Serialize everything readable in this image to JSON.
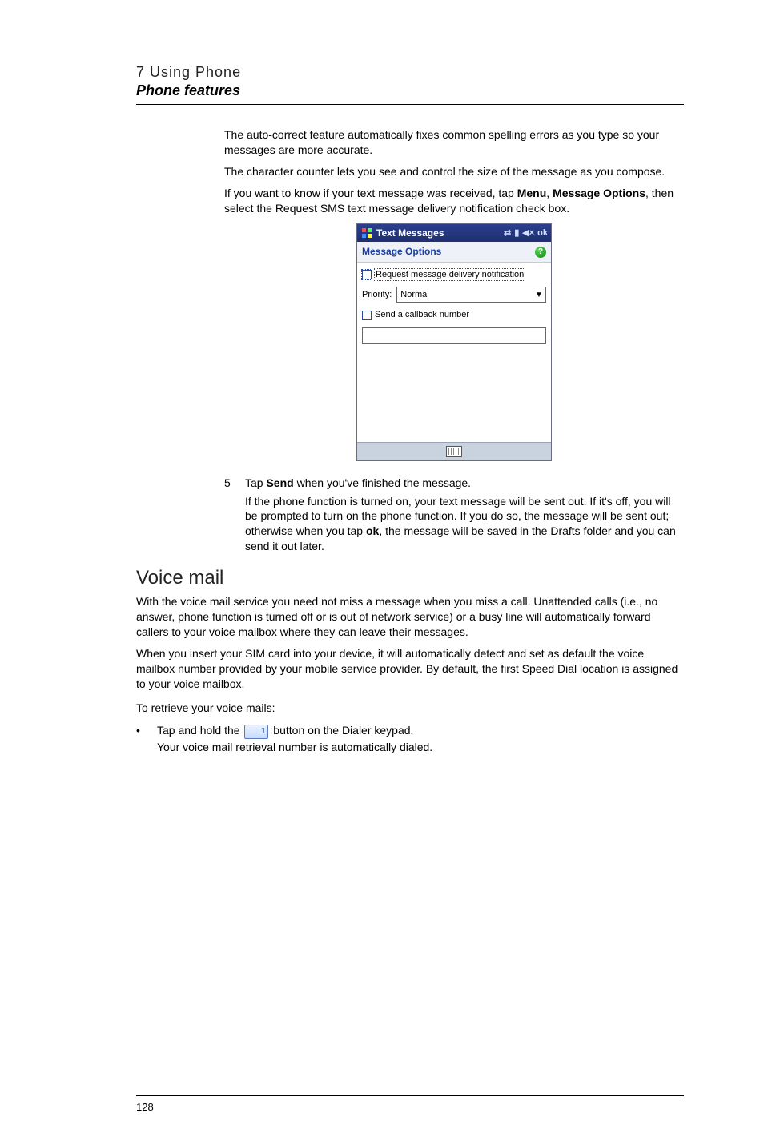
{
  "header": {
    "chapter": "7 Using Phone",
    "section": "Phone features"
  },
  "intro": {
    "p1": "The auto-correct feature automatically fixes common spelling errors as you type so your messages are more accurate.",
    "p2": "The character counter lets you see and control the size of the message as you compose.",
    "p3_pre": "If you want to know if your text message was received, tap ",
    "p3_b1": "Menu",
    "p3_mid": ", ",
    "p3_b2": "Message Options",
    "p3_post": ", then select the Request SMS text message delivery notification check box."
  },
  "mobile": {
    "title": "Text Messages",
    "ok": "ok",
    "subtitle": "Message Options",
    "opt_request": "Request message delivery notification",
    "priority_label": "Priority:",
    "priority_value": "Normal",
    "opt_callback": "Send a callback number"
  },
  "step5": {
    "num": "5",
    "pre": "Tap ",
    "b": "Send",
    "post": " when you've finished the message.",
    "follow_pre": "If the phone function is turned on, your text message will be sent out. If it's off, you will be prompted to turn on the phone function. If you do so, the message will be sent out; otherwise when you tap ",
    "follow_b": "ok",
    "follow_post": ", the message will be saved in the Drafts folder and you can send it out later."
  },
  "voicemail": {
    "heading": "Voice mail",
    "p1": "With the voice mail service you need not miss a message when you miss a call. Unattended calls (i.e., no answer, phone function is turned off or is out of network service) or a busy line will automatically forward callers to your voice mailbox where they can leave their messages.",
    "p2": "When you insert your SIM card into your device, it will automatically detect and set as default the voice mailbox number provided by your mobile service provider. By default, the first Speed Dial location is assigned to your voice mailbox.",
    "task": "To retrieve your voice mails:",
    "bullet_pre": "Tap and hold the ",
    "bullet_post": " button on the Dialer keypad.",
    "bullet_sub": "Your voice mail retrieval number is automatically dialed."
  },
  "page_number": "128"
}
